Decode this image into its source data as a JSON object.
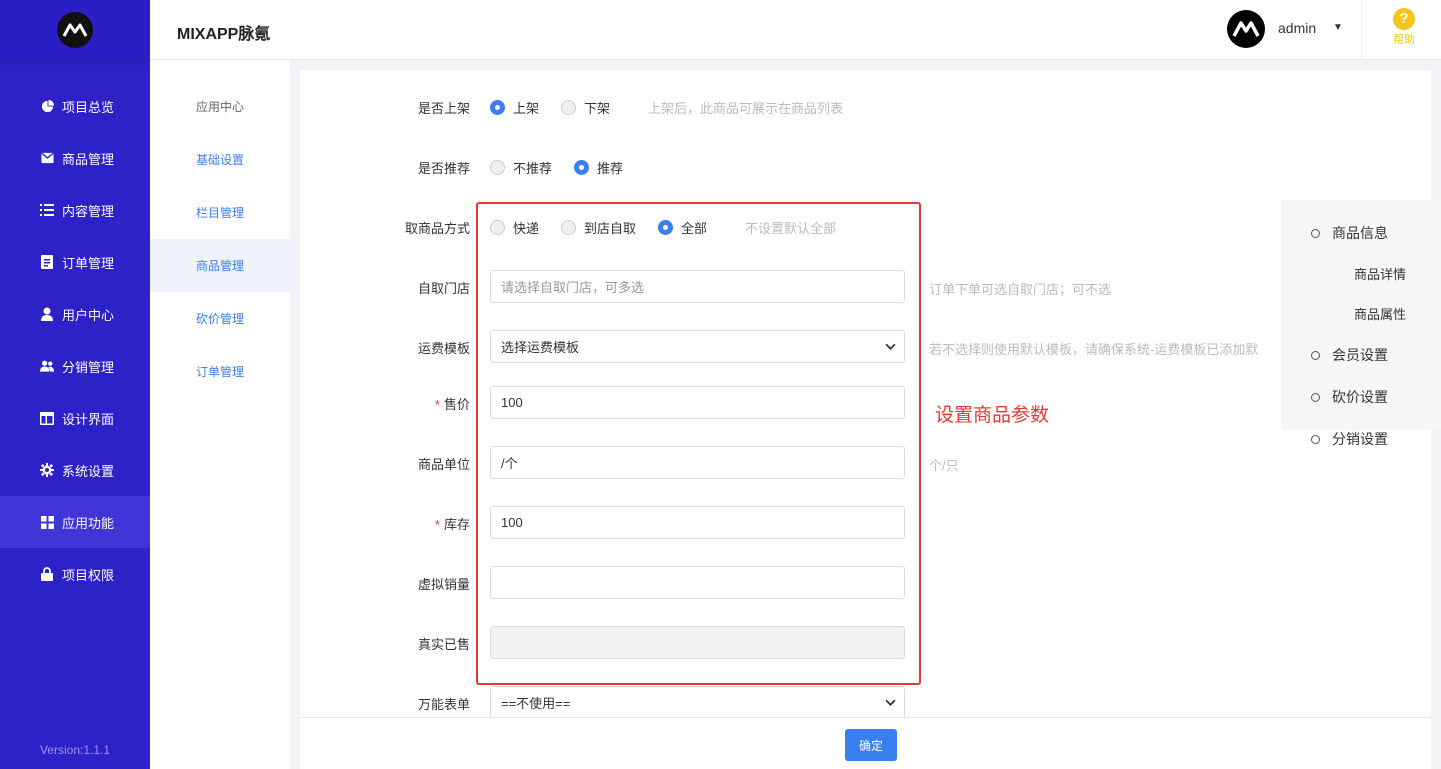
{
  "app": {
    "title": "MIXAPP脉氪",
    "logo_text": "M"
  },
  "header": {
    "user": "admin",
    "help_label": "帮助"
  },
  "sidebar": {
    "items": [
      {
        "label": "项目总览",
        "icon": "pie-chart-icon"
      },
      {
        "label": "商品管理",
        "icon": "mail-icon"
      },
      {
        "label": "内容管理",
        "icon": "list-icon"
      },
      {
        "label": "订单管理",
        "icon": "document-icon"
      },
      {
        "label": "用户中心",
        "icon": "user-icon"
      },
      {
        "label": "分销管理",
        "icon": "users-icon"
      },
      {
        "label": "设计界面",
        "icon": "layout-icon"
      },
      {
        "label": "系统设置",
        "icon": "gear-icon"
      },
      {
        "label": "应用功能",
        "icon": "grid-icon",
        "active": true
      },
      {
        "label": "项目权限",
        "icon": "lock-icon"
      }
    ],
    "version": "Version:1.1.1"
  },
  "submenu": {
    "items": [
      {
        "label": "应用中心"
      },
      {
        "label": "基础设置"
      },
      {
        "label": "栏目管理"
      },
      {
        "label": "商品管理",
        "active": true
      },
      {
        "label": "砍价管理"
      },
      {
        "label": "订单管理"
      }
    ]
  },
  "form": {
    "on_shelf": {
      "label": "是否上架",
      "opt1": "上架",
      "opt2": "下架",
      "selected": "上架",
      "hint": "上架后，此商品可展示在商品列表"
    },
    "recommend": {
      "label": "是否推荐",
      "opt1": "不推荐",
      "opt2": "推荐",
      "selected": "推荐"
    },
    "pickup": {
      "label": "取商品方式",
      "opt1": "快递",
      "opt2": "到店自取",
      "opt3": "全部",
      "selected": "全部",
      "hint": "不设置默认全部"
    },
    "store": {
      "label": "自取门店",
      "placeholder": "请选择自取门店，可多选",
      "hint": "订单下单可选自取门店；可不选"
    },
    "shipping": {
      "label": "运费模板",
      "value": "选择运费模板",
      "hint": "若不选择则使用默认模板，请确保系统-运费模板已添加默"
    },
    "price": {
      "label": "售价",
      "value": "100",
      "required": "*"
    },
    "unit": {
      "label": "商品单位",
      "value": "/个",
      "hint": "个/只"
    },
    "stock": {
      "label": "库存",
      "value": "100",
      "required": "*"
    },
    "virtual_sales": {
      "label": "虚拟销量",
      "value": ""
    },
    "real_sold": {
      "label": "真实已售",
      "value": ""
    },
    "universal_form": {
      "label": "万能表单",
      "value": "==不使用=="
    }
  },
  "annotation": "设置商品参数",
  "anchor": {
    "items": [
      {
        "label": "商品信息"
      },
      {
        "label": "商品详情"
      },
      {
        "label": "商品属性"
      },
      {
        "label": "会员设置"
      },
      {
        "label": "砍价设置"
      },
      {
        "label": "分销设置"
      }
    ]
  },
  "footer": {
    "confirm_label": "确定"
  },
  "colors": {
    "sidebar_bg": "#2c22c8",
    "accent": "#3b7ef0",
    "annotation_red": "#e53935",
    "help_yellow": "#f5c518"
  }
}
